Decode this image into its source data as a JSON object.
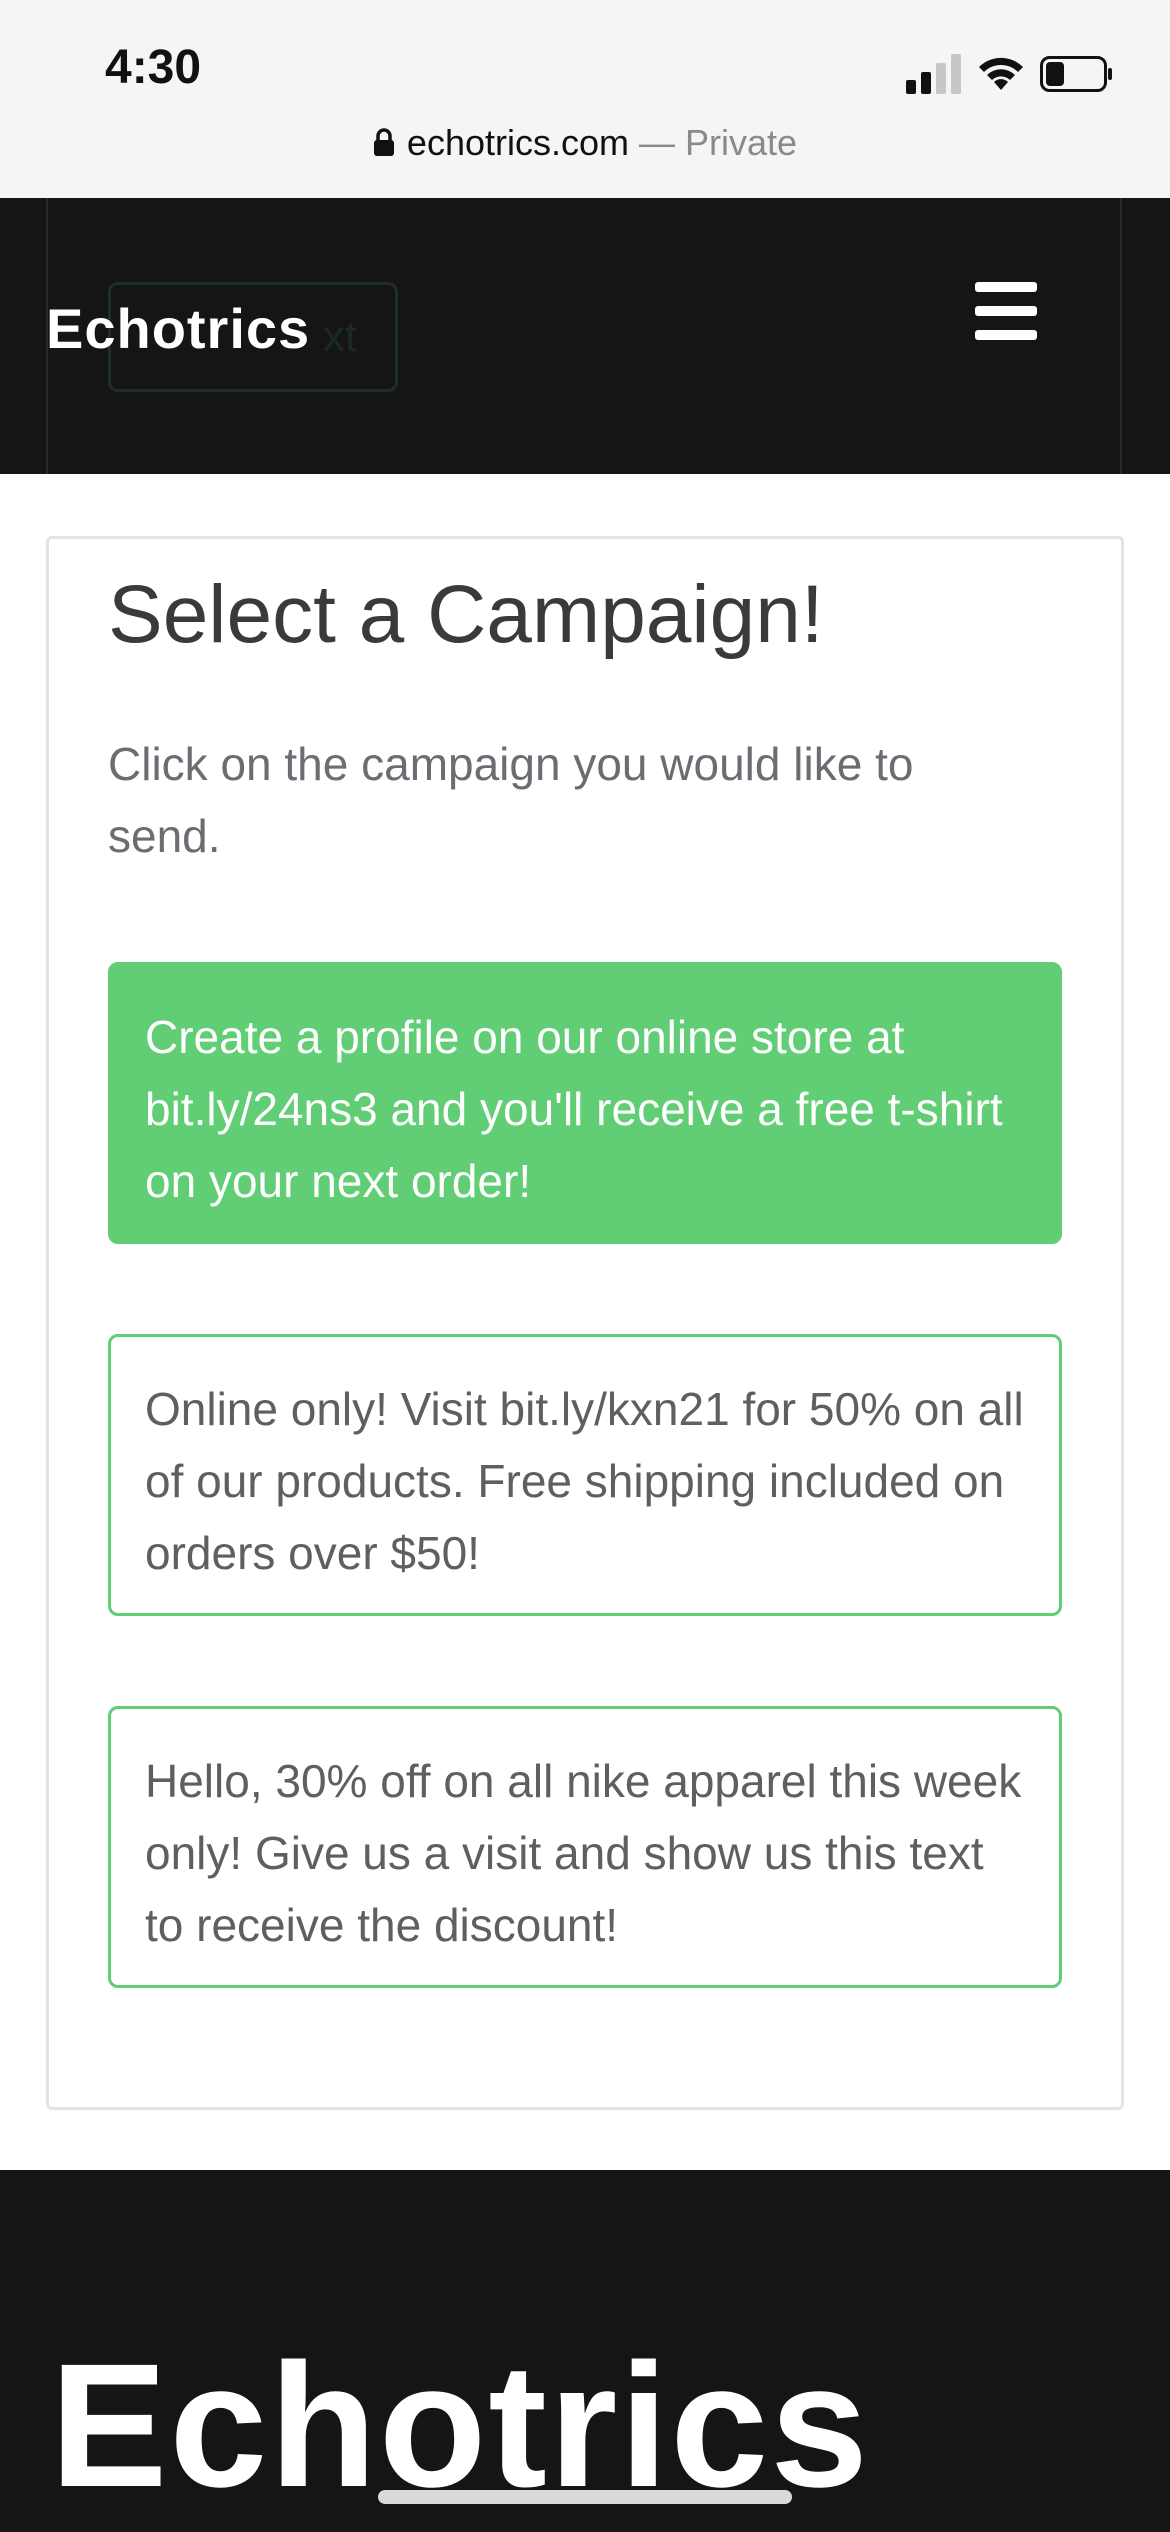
{
  "status_bar": {
    "time": "4:30",
    "icons": [
      "signal-icon",
      "wifi-icon",
      "battery-icon"
    ]
  },
  "address_bar": {
    "domain": "echotrics.com",
    "separator": " — ",
    "mode": "Private",
    "icon": "lock-icon"
  },
  "header": {
    "logo_text": "Echotrics",
    "hidden_button_label": "xt",
    "menu_icon": "hamburger-menu-icon"
  },
  "main": {
    "title": "Select a Campaign!",
    "description": "Click on the campaign you would like to send.",
    "campaigns": [
      {
        "text": "Create a profile on our online store at bit.ly/24ns3 and you'll receive a free t-shirt on your next order!",
        "selected": true
      },
      {
        "text": "Online only! Visit bit.ly/kxn21 for 50% on all of our products. Free shipping included on orders over $50!",
        "selected": false
      },
      {
        "text": "Hello, 30% off on all nike apparel this week only! Give us a visit and show us this text to receive the discount!",
        "selected": false
      }
    ]
  },
  "footer": {
    "logo_text": "Echotrics"
  },
  "colors": {
    "accent_green": "#61cd75",
    "header_bg": "#151515",
    "title_text": "#3a3a3a"
  }
}
